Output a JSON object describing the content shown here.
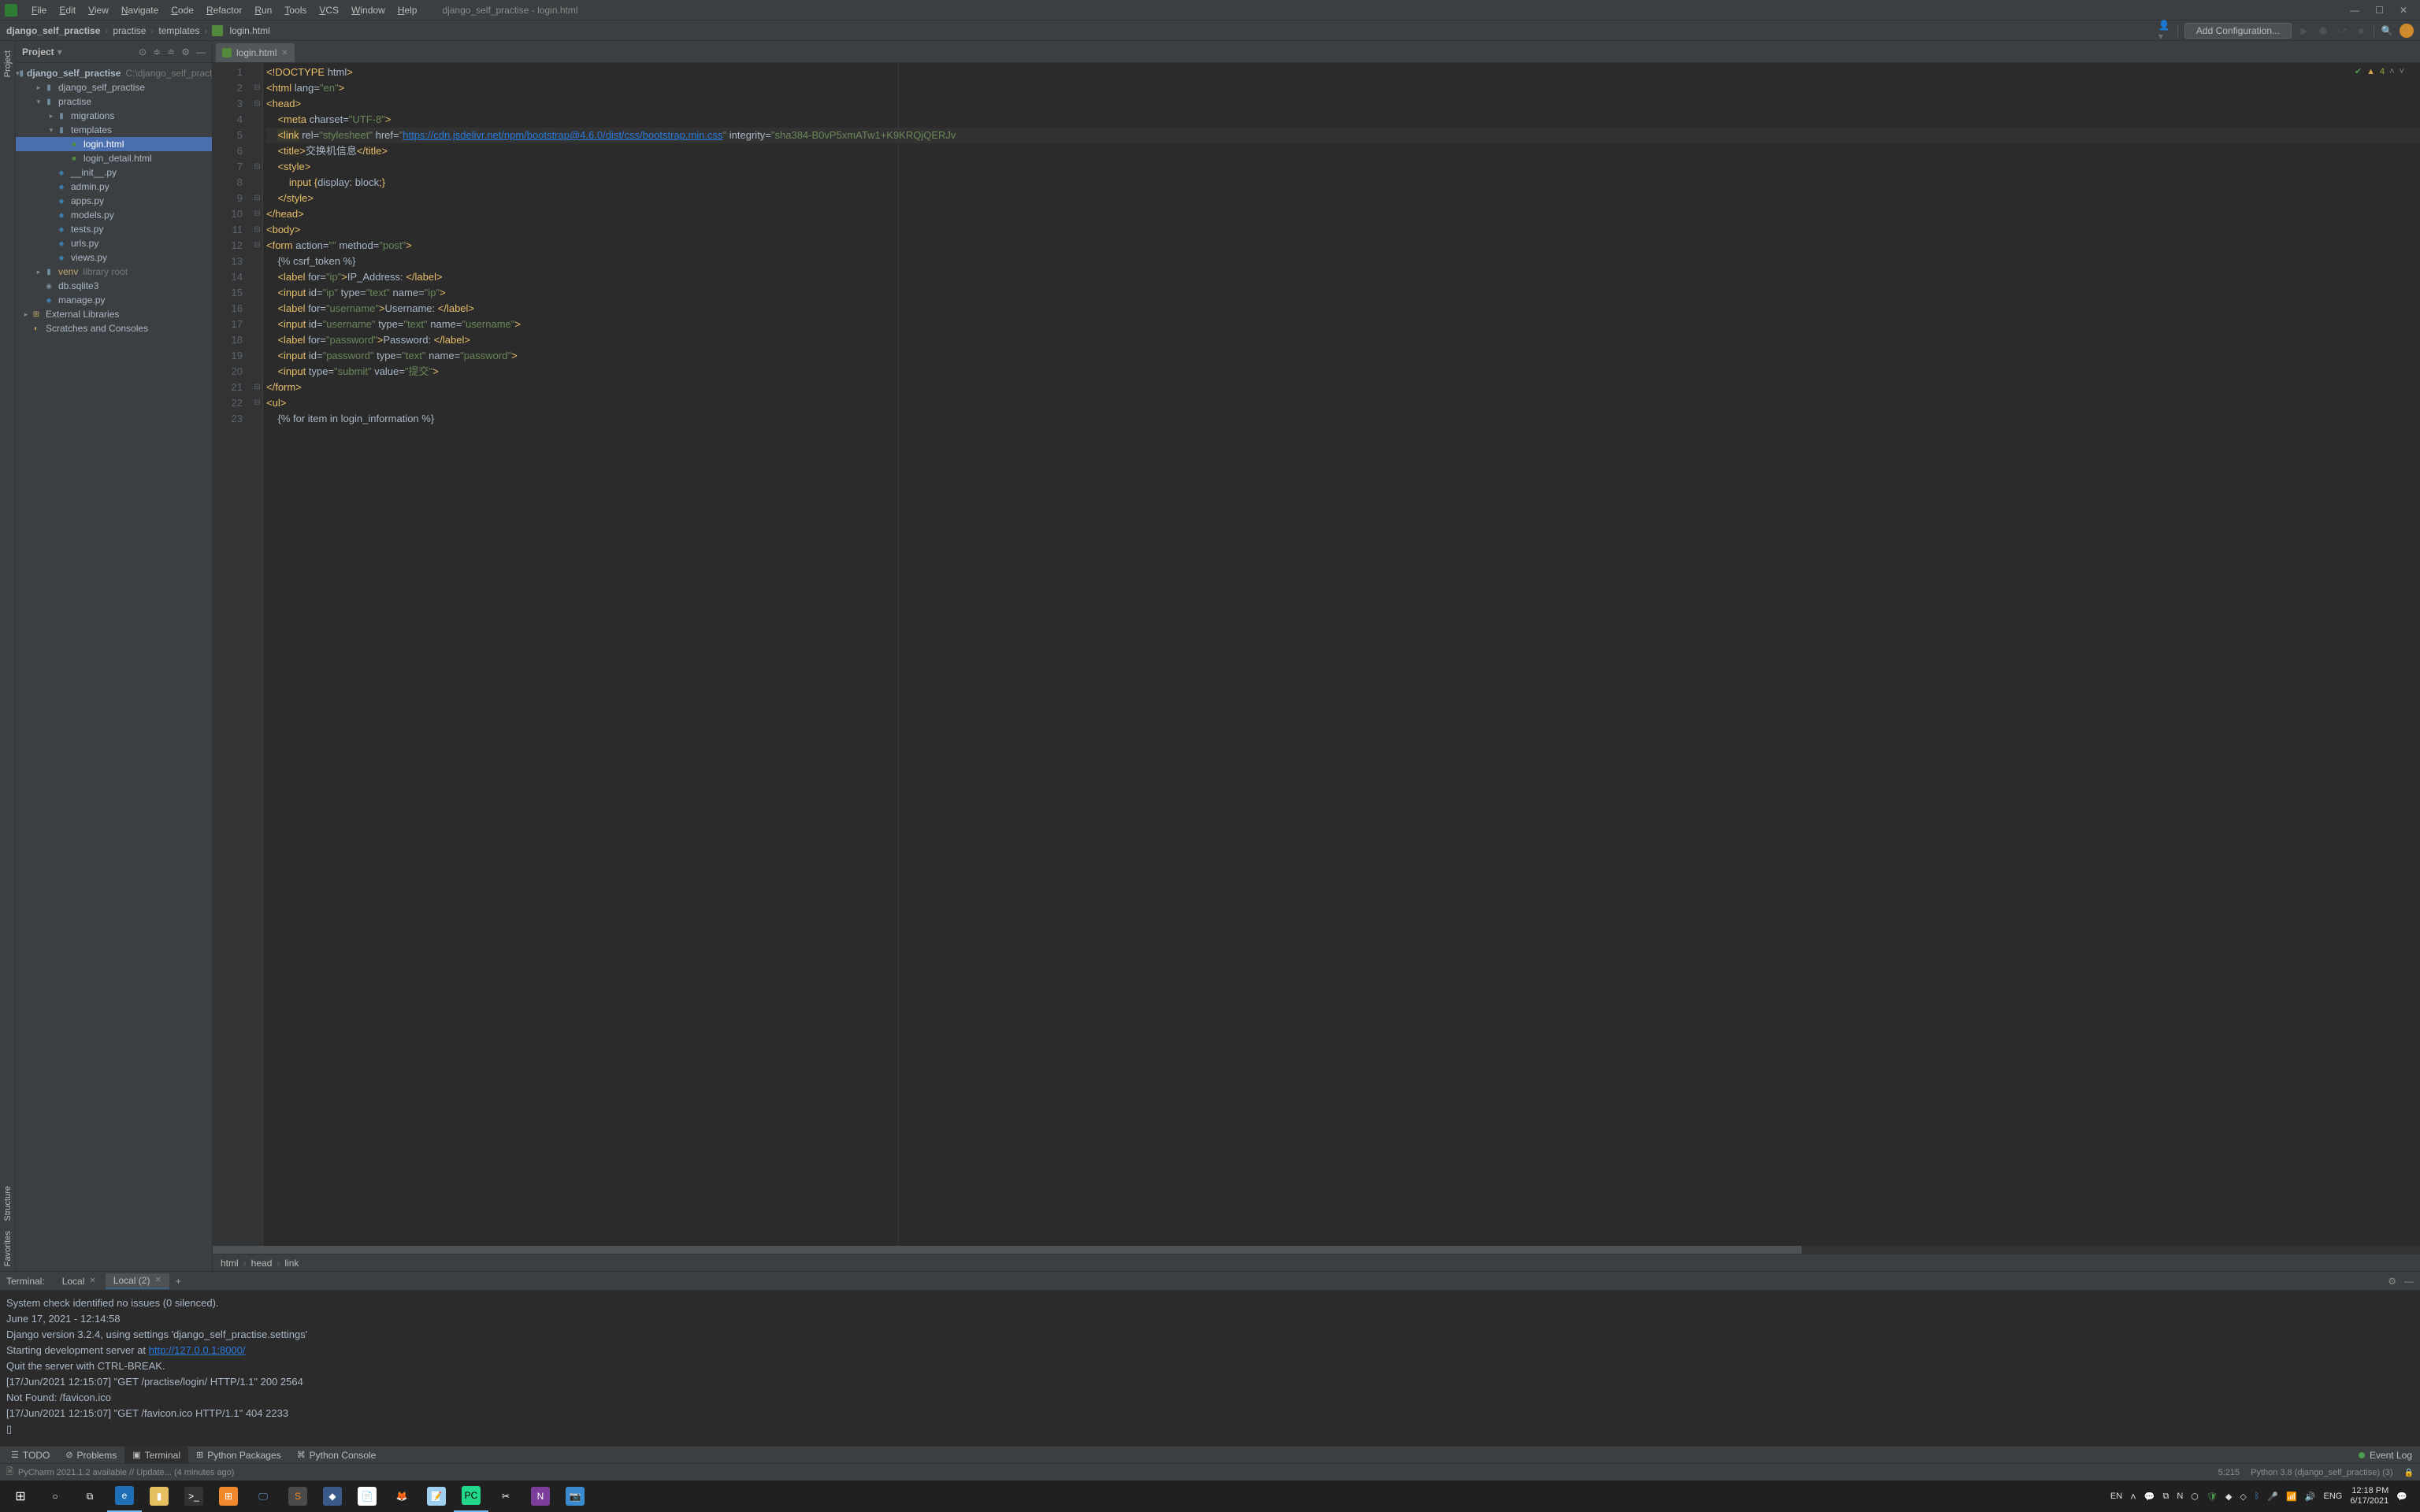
{
  "menu": {
    "items": [
      "File",
      "Edit",
      "View",
      "Navigate",
      "Code",
      "Refactor",
      "Run",
      "Tools",
      "VCS",
      "Window",
      "Help"
    ],
    "window_title": "django_self_practise - login.html"
  },
  "breadcrumb": {
    "parts": [
      "django_self_practise",
      "practise",
      "templates",
      "login.html"
    ]
  },
  "toolbar": {
    "add_config": "Add Configuration..."
  },
  "project": {
    "title": "Project",
    "tree": [
      {
        "indent": 0,
        "arrow": "▾",
        "icon": "folder",
        "label": "django_self_practise",
        "hint": "C:\\django_self_practi",
        "bold": true
      },
      {
        "indent": 1,
        "arrow": "▸",
        "icon": "folder",
        "label": "django_self_practise"
      },
      {
        "indent": 1,
        "arrow": "▾",
        "icon": "folder",
        "label": "practise"
      },
      {
        "indent": 2,
        "arrow": "▸",
        "icon": "folder",
        "label": "migrations"
      },
      {
        "indent": 2,
        "arrow": "▾",
        "icon": "folder",
        "label": "templates"
      },
      {
        "indent": 3,
        "arrow": "",
        "icon": "html",
        "label": "login.html",
        "selected": true
      },
      {
        "indent": 3,
        "arrow": "",
        "icon": "html",
        "label": "login_detail.html"
      },
      {
        "indent": 2,
        "arrow": "",
        "icon": "pyfile",
        "label": "__init__.py"
      },
      {
        "indent": 2,
        "arrow": "",
        "icon": "pyfile",
        "label": "admin.py"
      },
      {
        "indent": 2,
        "arrow": "",
        "icon": "pyfile",
        "label": "apps.py"
      },
      {
        "indent": 2,
        "arrow": "",
        "icon": "pyfile",
        "label": "models.py"
      },
      {
        "indent": 2,
        "arrow": "",
        "icon": "pyfile",
        "label": "tests.py"
      },
      {
        "indent": 2,
        "arrow": "",
        "icon": "pyfile",
        "label": "urls.py"
      },
      {
        "indent": 2,
        "arrow": "",
        "icon": "pyfile",
        "label": "views.py"
      },
      {
        "indent": 1,
        "arrow": "▸",
        "icon": "folder",
        "label": "venv",
        "hint": "library root",
        "special": true
      },
      {
        "indent": 1,
        "arrow": "",
        "icon": "db",
        "label": "db.sqlite3"
      },
      {
        "indent": 1,
        "arrow": "",
        "icon": "pyfile",
        "label": "manage.py"
      },
      {
        "indent": 0,
        "arrow": "▸",
        "icon": "lib",
        "label": "External Libraries"
      },
      {
        "indent": 0,
        "arrow": "",
        "icon": "scratch",
        "label": "Scratches and Consoles"
      }
    ]
  },
  "editor": {
    "tab": {
      "label": "login.html"
    },
    "status": {
      "count": "4"
    },
    "breadcrumb": [
      "html",
      "head",
      "link"
    ],
    "lines": [
      {
        "n": 1,
        "html": "<span class='pun'>&lt;!</span><span class='tag'>DOCTYPE </span><span class='attr'>html</span><span class='pun'>&gt;</span>",
        "fold": ""
      },
      {
        "n": 2,
        "html": "<span class='pun'>&lt;</span><span class='tag'>html </span><span class='attr'>lang</span><span class='eq'>=</span><span class='str'>\"en\"</span><span class='pun'>&gt;</span>",
        "fold": "⊟"
      },
      {
        "n": 3,
        "html": "<span class='pun'>&lt;</span><span class='tag'>head</span><span class='pun'>&gt;</span>",
        "fold": "⊟"
      },
      {
        "n": 4,
        "html": "    <span class='pun'>&lt;</span><span class='tag'>meta </span><span class='attr'>charset</span><span class='eq'>=</span><span class='str'>\"UTF-8\"</span><span class='pun'>&gt;</span>",
        "fold": ""
      },
      {
        "n": 5,
        "html": "    <span class='warn'><span class='pun'>&lt;</span><span class='tag'>link</span></span> <span class='attr'>rel</span><span class='eq'>=</span><span class='str'>\"stylesheet\"</span> <span class='attr'>href</span><span class='eq'>=</span><span class='str'>\"<span class='link'>https://cdn.jsdelivr.net/npm/bootstrap@4.6.0/dist/css/bootstrap.min.css</span>\"</span> <span class='attr'>integrity</span><span class='eq'>=</span><span class='str'>\"sha384-B0vP5xmATw1+K9KRQjQERJv</span>",
        "fold": "",
        "hl": true
      },
      {
        "n": 6,
        "html": "    <span class='pun'>&lt;</span><span class='tag'>title</span><span class='pun'>&gt;</span><span class='text'>交换机信息</span><span class='pun'>&lt;/</span><span class='tag'>title</span><span class='pun'>&gt;</span>",
        "fold": ""
      },
      {
        "n": 7,
        "html": "    <span class='pun'>&lt;</span><span class='tag'>style</span><span class='pun'>&gt;</span>",
        "fold": "⊟"
      },
      {
        "n": 8,
        "html": "        <span class='tag'>input </span><span class='pun'>{</span><span class='attr'>display</span><span class='pun'>: </span><span class='attr'>block</span><span class='pun'>;}</span>",
        "fold": ""
      },
      {
        "n": 9,
        "html": "    <span class='pun'>&lt;/</span><span class='tag'>style</span><span class='pun'>&gt;</span>",
        "fold": "⊟"
      },
      {
        "n": 10,
        "html": "<span class='pun'>&lt;/</span><span class='tag'>head</span><span class='pun'>&gt;</span>",
        "fold": "⊟"
      },
      {
        "n": 11,
        "html": "<span class='pun'>&lt;</span><span class='tag'>body</span><span class='pun'>&gt;</span>",
        "fold": "⊟"
      },
      {
        "n": 12,
        "html": "<span class='pun'>&lt;</span><span class='tag'>form </span><span class='attr'>action</span><span class='eq'>=</span><span class='str'>\"\"</span> <span class='attr'>method</span><span class='eq'>=</span><span class='str'>\"post\"</span><span class='pun'>&gt;</span>",
        "fold": "⊟"
      },
      {
        "n": 13,
        "html": "    <span class='text'>{% csrf_token %}</span>",
        "fold": ""
      },
      {
        "n": 14,
        "html": "    <span class='pun'>&lt;</span><span class='tag'>label </span><span class='attr'>for</span><span class='eq'>=</span><span class='str'>\"ip\"</span><span class='pun'>&gt;</span><span class='text'>IP_Address: </span><span class='pun'>&lt;/</span><span class='tag'>label</span><span class='pun'>&gt;</span>",
        "fold": ""
      },
      {
        "n": 15,
        "html": "    <span class='pun'>&lt;</span><span class='tag'>input </span><span class='attr'>id</span><span class='eq'>=</span><span class='str'>\"ip\"</span> <span class='attr'>type</span><span class='eq'>=</span><span class='str'>\"text\"</span> <span class='attr'>name</span><span class='eq'>=</span><span class='str'>\"ip\"</span><span class='pun'>&gt;</span>",
        "fold": ""
      },
      {
        "n": 16,
        "html": "    <span class='pun'>&lt;</span><span class='tag'>label </span><span class='attr'>for</span><span class='eq'>=</span><span class='str'>\"username\"</span><span class='pun'>&gt;</span><span class='text'>Username: </span><span class='pun'>&lt;/</span><span class='tag'>label</span><span class='pun'>&gt;</span>",
        "fold": ""
      },
      {
        "n": 17,
        "html": "    <span class='pun'>&lt;</span><span class='tag'>input </span><span class='attr'>id</span><span class='eq'>=</span><span class='str'>\"username\"</span> <span class='attr'>type</span><span class='eq'>=</span><span class='str'>\"text\"</span> <span class='attr'>name</span><span class='eq'>=</span><span class='str'>\"username\"</span><span class='pun'>&gt;</span>",
        "fold": ""
      },
      {
        "n": 18,
        "html": "    <span class='pun'>&lt;</span><span class='tag'>label </span><span class='attr'>for</span><span class='eq'>=</span><span class='str'>\"password\"</span><span class='pun'>&gt;</span><span class='text'>Password: </span><span class='pun'>&lt;/</span><span class='tag'>label</span><span class='pun'>&gt;</span>",
        "fold": ""
      },
      {
        "n": 19,
        "html": "    <span class='pun'>&lt;</span><span class='tag'>input </span><span class='attr'>id</span><span class='eq'>=</span><span class='str'>\"password\"</span> <span class='attr'>type</span><span class='eq'>=</span><span class='str'>\"text\"</span> <span class='attr'>name</span><span class='eq'>=</span><span class='str'>\"password\"</span><span class='pun'>&gt;</span>",
        "fold": ""
      },
      {
        "n": 20,
        "html": "    <span class='pun'>&lt;</span><span class='tag'>input </span><span class='attr'>type</span><span class='eq'>=</span><span class='str'>\"submit\"</span> <span class='attr'>value</span><span class='eq'>=</span><span class='str'>\"提交\"</span><span class='pun'>&gt;</span>",
        "fold": ""
      },
      {
        "n": 21,
        "html": "<span class='pun'>&lt;/</span><span class='tag'>form</span><span class='pun'>&gt;</span>",
        "fold": "⊟"
      },
      {
        "n": 22,
        "html": "<span class='pun'>&lt;</span><span class='tag'>ul</span><span class='pun'>&gt;</span>",
        "fold": "⊟"
      },
      {
        "n": 23,
        "html": "    <span class='text'>{% for item in login_information %}</span>",
        "fold": ""
      }
    ]
  },
  "terminal": {
    "title": "Terminal:",
    "tabs": [
      {
        "label": "Local",
        "active": false
      },
      {
        "label": "Local (2)",
        "active": true
      }
    ],
    "lines": [
      {
        "text": "System check identified no issues (0 silenced)."
      },
      {
        "text": "June 17, 2021 - 12:14:58"
      },
      {
        "text": "Django version 3.2.4, using settings 'django_self_practise.settings'"
      },
      {
        "text": "Starting development server at ",
        "link": "http://127.0.0.1:8000/"
      },
      {
        "text": "Quit the server with CTRL-BREAK."
      },
      {
        "text": "[17/Jun/2021 12:15:07] \"GET /practise/login/ HTTP/1.1\" 200 2564"
      },
      {
        "text": "Not Found: /favicon.ico"
      },
      {
        "text": "[17/Jun/2021 12:15:07] \"GET /favicon.ico HTTP/1.1\" 404 2233"
      },
      {
        "text": "▯"
      }
    ]
  },
  "bottom": {
    "todo": "TODO",
    "problems": "Problems",
    "terminal": "Terminal",
    "packages": "Python Packages",
    "console": "Python Console",
    "event_log": "Event Log"
  },
  "status": {
    "message": "PyCharm 2021.1.2 available // Update... (4 minutes ago)",
    "pos": "5:215",
    "interpreter": "Python 3.8 (django_self_practise) (3)"
  },
  "taskbar": {
    "lang": "EN",
    "ime": "ENG",
    "time": "12:18 PM",
    "date": "6/17/2021"
  },
  "side_labels": {
    "project": "Project",
    "structure": "Structure",
    "favorites": "Favorites"
  }
}
